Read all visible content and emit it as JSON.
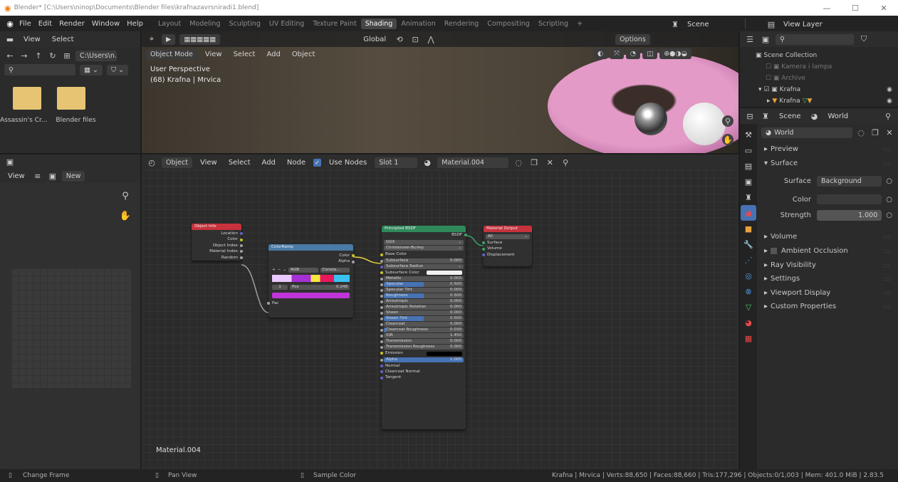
{
  "window": {
    "title": "Blender* [C:\\Users\\ninop\\Documents\\Blender files\\krafnazavrsniradi1.blend]",
    "min": "—",
    "max": "☐",
    "close": "✕"
  },
  "menu": [
    "File",
    "Edit",
    "Render",
    "Window",
    "Help"
  ],
  "workspace_tabs": [
    "Layout",
    "Modeling",
    "Sculpting",
    "UV Editing",
    "Texture Paint",
    "Shading",
    "Animation",
    "Rendering",
    "Compositing",
    "Scripting",
    "+"
  ],
  "scene_label": "Scene",
  "view_layer_label": "View Layer",
  "filebrowser": {
    "view": "View",
    "select": "Select",
    "path": "C:\\Users\\n...",
    "folders": [
      "Assassin's Cr...",
      "Blender files"
    ]
  },
  "image_editor": {
    "view": "View",
    "new": "New"
  },
  "viewport": {
    "mode": "Object Mode",
    "menus": [
      "View",
      "Select",
      "Add",
      "Object"
    ],
    "perspective": "User Perspective",
    "info": "(68) Krafna | Mrvica",
    "orientation": "Global",
    "options": "Options"
  },
  "node_editor": {
    "object": "Object",
    "menus": [
      "View",
      "Select",
      "Add",
      "Node"
    ],
    "use_nodes": "Use Nodes",
    "slot": "Slot 1",
    "material": "Material.004",
    "footer_label": "Material.004"
  },
  "nodes": {
    "object_info": {
      "title": "Object Info",
      "outputs": [
        "Location",
        "Color",
        "Object Index",
        "Material Index",
        "Random"
      ]
    },
    "colorramp": {
      "title": "ColorRamp",
      "outputs": [
        "Color",
        "Alpha"
      ],
      "mode": "RGB",
      "interp": "Consta...",
      "index": "1",
      "pos_label": "Pos",
      "pos_value": "0.248",
      "input": "Fac"
    },
    "bsdf": {
      "title": "Principled BSDF",
      "output": "BSDF",
      "dist": "GGX",
      "sss": "Christensen-Burley",
      "fields": [
        {
          "label": "Base Color",
          "type": "socket"
        },
        {
          "label": "Subsurface",
          "value": "0.000",
          "fill": 0
        },
        {
          "label": "Subsurface Radius",
          "type": "dropdown"
        },
        {
          "label": "Subsurface Color",
          "type": "color",
          "color": "#f0f0f0"
        },
        {
          "label": "Metallic",
          "value": "0.000",
          "fill": 0
        },
        {
          "label": "Specular",
          "value": "0.500",
          "fill": 0.5
        },
        {
          "label": "Specular Tint",
          "value": "0.000",
          "fill": 0
        },
        {
          "label": "Roughness",
          "value": "0.500",
          "fill": 0.5
        },
        {
          "label": "Anisotropic",
          "value": "0.000",
          "fill": 0
        },
        {
          "label": "Anisotropic Rotation",
          "value": "0.000",
          "fill": 0
        },
        {
          "label": "Sheen",
          "value": "0.000",
          "fill": 0
        },
        {
          "label": "Sheen Tint",
          "value": "0.500",
          "fill": 0.5
        },
        {
          "label": "Clearcoat",
          "value": "0.000",
          "fill": 0
        },
        {
          "label": "Clearcoat Roughness",
          "value": "0.030",
          "fill": 0.03
        },
        {
          "label": "IOR",
          "value": "1.450",
          "fill": 0
        },
        {
          "label": "Transmission",
          "value": "0.000",
          "fill": 0
        },
        {
          "label": "Transmission Roughness",
          "value": "0.000",
          "fill": 0
        },
        {
          "label": "Emission",
          "type": "color",
          "color": "#000000"
        },
        {
          "label": "Alpha",
          "value": "1.000",
          "fill": 1
        },
        {
          "label": "Normal",
          "type": "socket"
        },
        {
          "label": "Clearcoat Normal",
          "type": "socket"
        },
        {
          "label": "Tangent",
          "type": "socket"
        }
      ]
    },
    "output": {
      "title": "Material Output",
      "target": "All",
      "inputs": [
        "Surface",
        "Volume",
        "Displacement"
      ]
    }
  },
  "outliner": {
    "title": "Scene Collection",
    "items": [
      {
        "label": "Kamera i lampa",
        "dim": true
      },
      {
        "label": "Archive",
        "dim": true
      },
      {
        "label": "Krafna",
        "dim": false
      }
    ],
    "child": "Krafna"
  },
  "properties": {
    "tabs": [
      "Scene",
      "World"
    ],
    "world": "World",
    "sections": [
      "Preview",
      "Surface"
    ],
    "surface_label": "Surface",
    "surface_value": "Background",
    "color_label": "Color",
    "strength_label": "Strength",
    "strength_value": "1.000",
    "more": [
      "Volume",
      "Ambient Occlusion",
      "Ray Visibility",
      "Settings",
      "Viewport Display",
      "Custom Properties"
    ]
  },
  "statusbar": {
    "left": "Change Frame",
    "mid": "Pan View",
    "right_hint": "Sample Color",
    "info": "Krafna | Mrvica | Verts:88,650 | Faces:88,660 | Tris:177,296 | Objects:0/1,003 | Mem: 401.0 MiB | 2.83.5"
  },
  "colors": {
    "accent": "#4772b3",
    "header_red": "#c8323c",
    "header_blue": "#4a7ba6",
    "header_green": "#2f8a5a"
  }
}
